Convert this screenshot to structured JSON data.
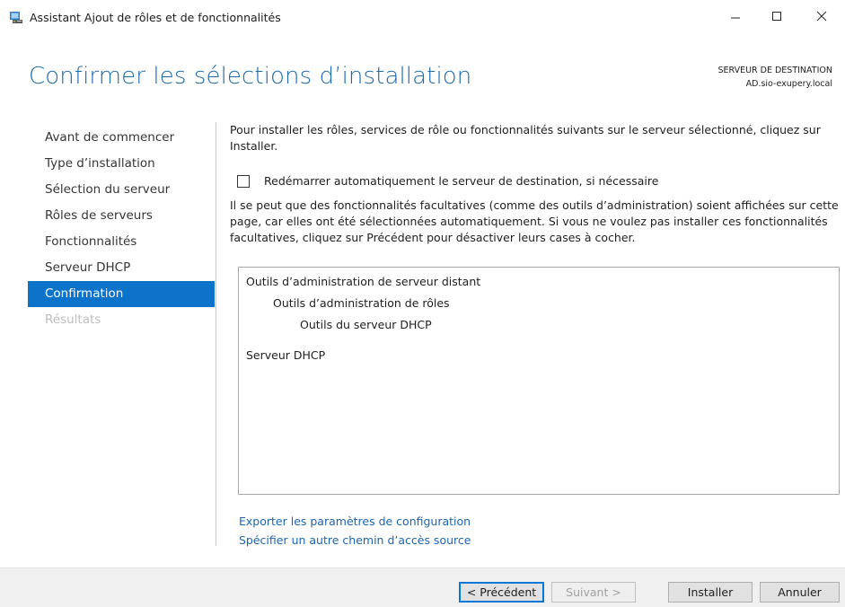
{
  "window": {
    "title": "Assistant Ajout de rôles et de fonctionnalités",
    "controls": {
      "minimize": "minimize-icon",
      "maximize": "maximize-icon",
      "close": "close-icon"
    },
    "app_icon": "server-manager-icon"
  },
  "header": {
    "page_title": "Confirmer les sélections d’installation",
    "destination_label": "SERVEUR DE DESTINATION",
    "destination_server": "AD.sio-exupery.local"
  },
  "nav": {
    "items": [
      {
        "label": "Avant de commencer",
        "state": "normal"
      },
      {
        "label": "Type d’installation",
        "state": "normal"
      },
      {
        "label": "Sélection du serveur",
        "state": "normal"
      },
      {
        "label": "Rôles de serveurs",
        "state": "normal"
      },
      {
        "label": "Fonctionnalités",
        "state": "normal"
      },
      {
        "label": "Serveur DHCP",
        "state": "normal"
      },
      {
        "label": "Confirmation",
        "state": "active"
      },
      {
        "label": "Résultats",
        "state": "disabled"
      }
    ]
  },
  "content": {
    "intro": "Pour installer les rôles, services de rôle ou fonctionnalités suivants sur le serveur sélectionné, cliquez sur Installer.",
    "restart_checkbox": {
      "label": "Redémarrer automatiquement le serveur de destination, si nécessaire",
      "checked": false
    },
    "note": "Il se peut que des fonctionnalités facultatives (comme des outils d’administration) soient affichées sur cette page, car elles ont été sélectionnées automatiquement. Si vous ne voulez pas installer ces fonctionnalités facultatives, cliquez sur Précédent pour désactiver leurs cases à cocher.",
    "selections": [
      {
        "label": "Outils d’administration de serveur distant",
        "level": 0
      },
      {
        "label": "Outils d’administration de rôles",
        "level": 1
      },
      {
        "label": "Outils du serveur DHCP",
        "level": 2
      },
      {
        "label": "Serveur DHCP",
        "level": 0
      }
    ],
    "links": {
      "export": "Exporter les paramètres de configuration",
      "alternate_source": "Spécifier un autre chemin d’accès source"
    }
  },
  "footer": {
    "previous": "< Précédent",
    "next": "Suivant >",
    "install": "Installer",
    "cancel": "Annuler"
  },
  "colors": {
    "accent": "#0b73c9",
    "title": "#1e6bb0",
    "link": "#1b66b1"
  }
}
